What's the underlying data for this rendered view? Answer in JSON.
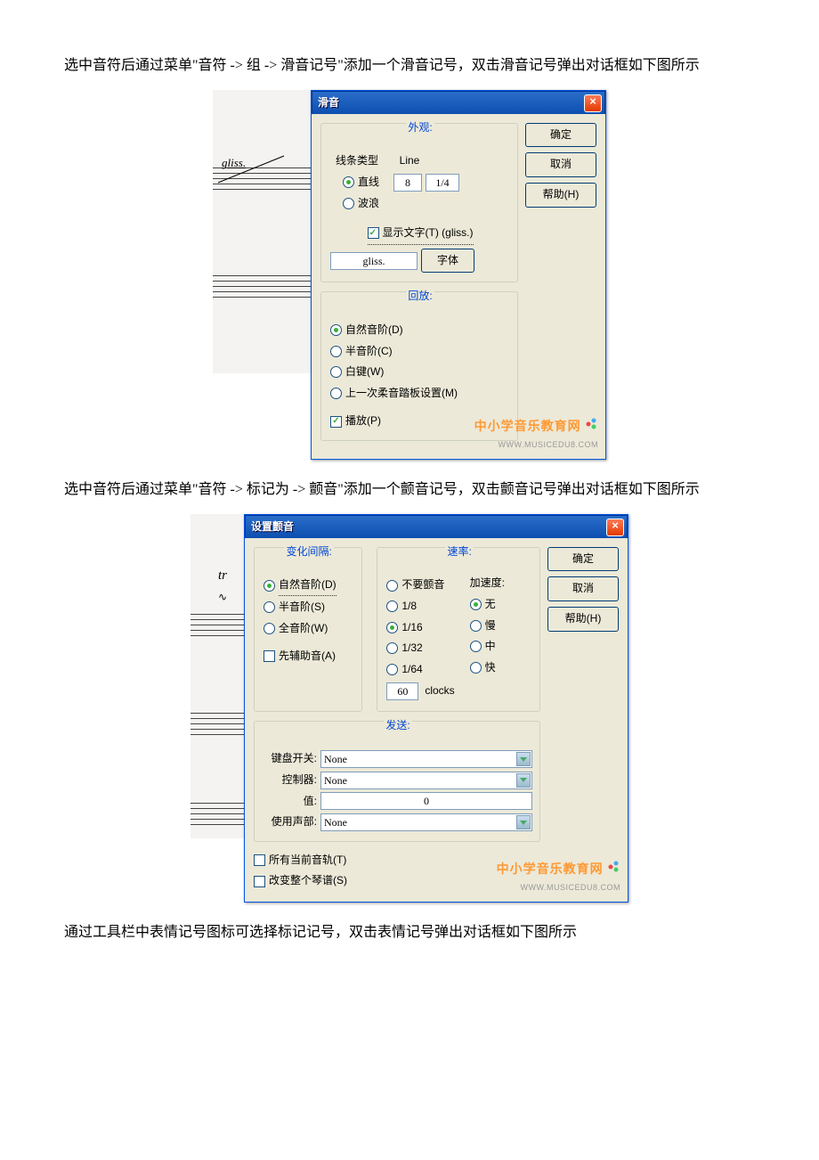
{
  "para1": "选中音符后通过菜单\"音符 -> 组 -> 滑音记号\"添加一个滑音记号，双击滑音记号弹出对话框如下图所示",
  "para2": "选中音符后通过菜单\"音符 -> 标记为 -> 颤音\"添加一个颤音记号，双击颤音记号弹出对话框如下图所示",
  "para3": "通过工具栏中表情记号图标可选择标记记号，双击表情记号弹出对话框如下图所示",
  "gliss_label": "gliss.",
  "dialog1": {
    "title": "滑音",
    "close": "×",
    "group_appearance": "外观:",
    "line_type_label": "线条类型",
    "line_header": "Line",
    "radio_straight": "直线",
    "radio_wave": "波浪",
    "val_a": "8",
    "val_b": "1/4",
    "cb_showtext": "显示文字(T) (gliss.)",
    "text_input": "gliss.",
    "btn_font": "字体",
    "group_playback": "回放:",
    "radio_natural": "自然音阶(D)",
    "radio_chromatic": "半音阶(C)",
    "radio_white": "白键(W)",
    "radio_soft": "上一次柔音踏板设置(M)",
    "cb_play": "播放(P)",
    "btn_ok": "确定",
    "btn_cancel": "取消",
    "btn_help": "帮助(H)"
  },
  "dialog2": {
    "title": "设置颤音",
    "close": "×",
    "group_interval": "变化间隔:",
    "radio_natural": "自然音阶(D)",
    "radio_half": "半音阶(S)",
    "radio_whole": "全音阶(W)",
    "cb_aux": "先辅助音(A)",
    "group_rate": "速率:",
    "radio_none": "不要颤音",
    "radio_1_8": "1/8",
    "radio_1_16": "1/16",
    "radio_1_32": "1/32",
    "radio_1_64": "1/64",
    "clocks_val": "60",
    "clocks_label": "clocks",
    "accel_label": "加速度:",
    "radio_a_none": "无",
    "radio_a_slow": "慢",
    "radio_a_mid": "中",
    "radio_a_fast": "快",
    "group_send": "发送:",
    "lbl_kbswitch": "键盘开关:",
    "lbl_controller": "控制器:",
    "lbl_value": "值:",
    "lbl_voice": "使用声部:",
    "val_none": "None",
    "val_zero": "0",
    "cb_alltracks": "所有当前音轨(T)",
    "cb_wholescore": "改变整个琴谱(S)",
    "btn_ok": "确定",
    "btn_cancel": "取消",
    "btn_help": "帮助(H)"
  },
  "tr_symbol": "tr",
  "watermark": {
    "cn1": "中",
    "cn2": "小",
    "cn3": "学音乐教育网",
    "en": "WWW.MUSICEDU8.COM"
  }
}
